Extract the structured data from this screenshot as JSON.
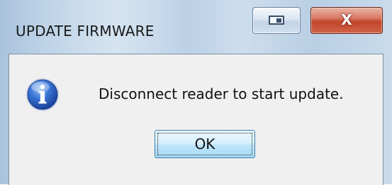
{
  "window": {
    "title": "UPDATE FIRMWARE",
    "close_label": "X"
  },
  "dialog": {
    "icon": "information-icon",
    "message": "Disconnect reader to start update.",
    "ok_label": "OK"
  },
  "colors": {
    "icon_blue": "#2f64c8",
    "close_red": "#c2462b"
  }
}
